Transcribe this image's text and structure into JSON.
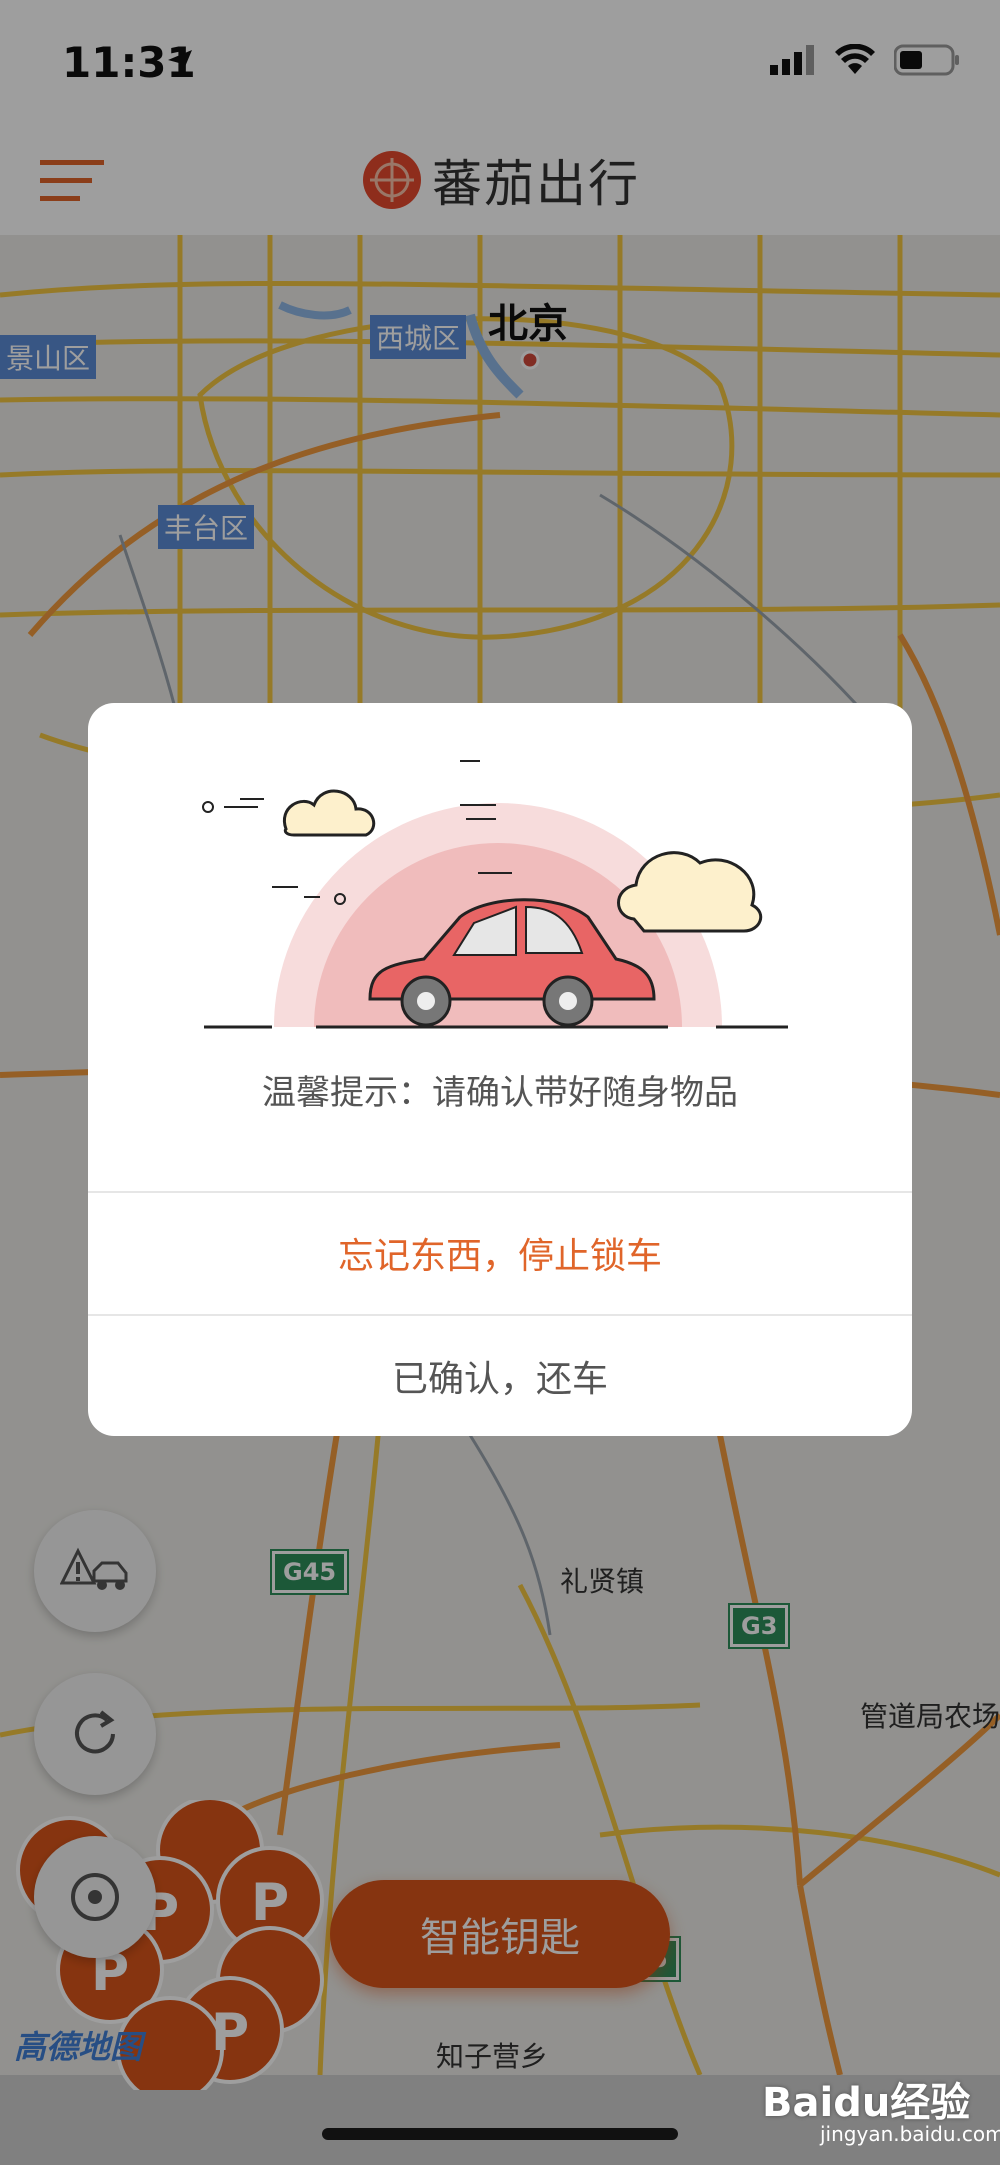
{
  "status_bar": {
    "time": "11:31"
  },
  "header": {
    "title": "蕃茄出行"
  },
  "map": {
    "city_label": "北京",
    "districts": [
      "景山区",
      "西城区",
      "丰台区"
    ],
    "places": [
      "礼贤镇",
      "管道局农场",
      "知子营乡"
    ],
    "highways": [
      "G45",
      "G3",
      "5"
    ],
    "provider": "高德地图"
  },
  "buttons": {
    "smart_key": "智能钥匙"
  },
  "modal": {
    "message": "温馨提示：请确认带好随身物品",
    "stop_label": "忘记东西，停止锁车",
    "confirm_label": "已确认，还车"
  },
  "watermark": {
    "brand": "Baidu经验",
    "url": "jingyan.baidu.com"
  },
  "colors": {
    "accent": "#e0652a",
    "key_button": "#d9551a",
    "map_road": "#f2c641",
    "map_road_orange": "#f09a3e"
  },
  "icons": [
    "menu-icon",
    "tomato-logo-icon",
    "location-arrow-icon",
    "signal-icon",
    "wifi-icon",
    "battery-icon",
    "car-warning-icon",
    "refresh-icon",
    "locate-icon",
    "parking-pin-icon"
  ]
}
